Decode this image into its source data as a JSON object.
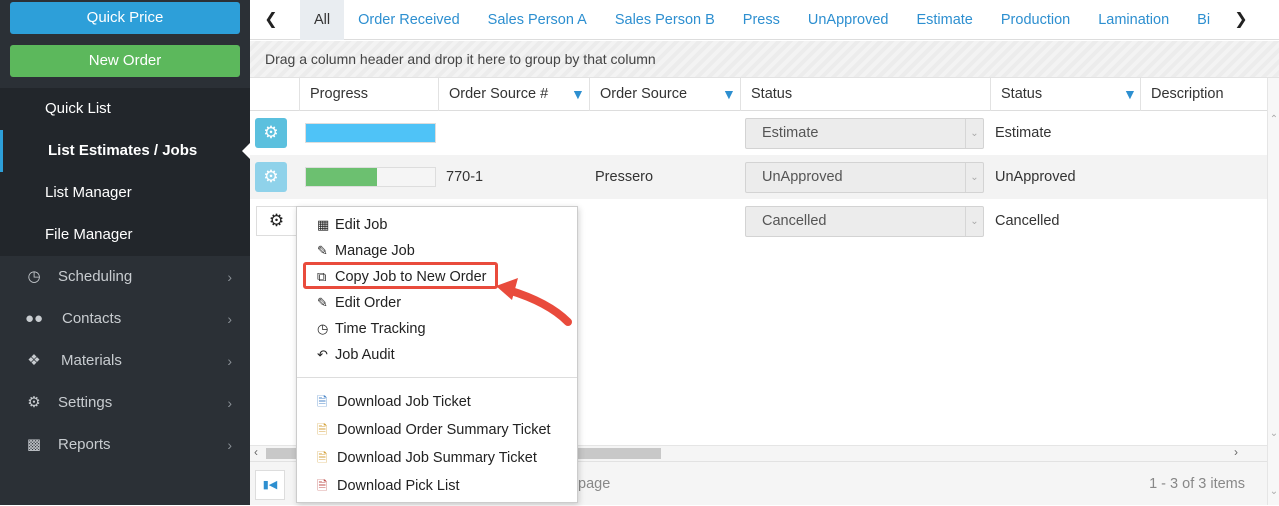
{
  "sidebar": {
    "quick_price": "Quick Price",
    "new_order": "New Order",
    "sub_items": [
      "Quick List",
      "List Estimates / Jobs",
      "List Manager",
      "File Manager"
    ],
    "nav": [
      {
        "label": "Scheduling",
        "icon": "clock-icon"
      },
      {
        "label": "Contacts",
        "icon": "users-icon"
      },
      {
        "label": "Materials",
        "icon": "dropbox-icon"
      },
      {
        "label": "Settings",
        "icon": "gear-icon"
      },
      {
        "label": "Reports",
        "icon": "file-icon"
      }
    ]
  },
  "tabs": [
    "All",
    "Order Received",
    "Sales Person A",
    "Sales Person B",
    "Press",
    "UnApproved",
    "Estimate",
    "Production",
    "Lamination",
    "Bi"
  ],
  "group_hint": "Drag a column header and drop it here to group by that column",
  "columns": [
    "Progress",
    "Order Source #",
    "Order Source",
    "Status",
    "Status",
    "Description"
  ],
  "rows": [
    {
      "progress": 1.0,
      "progress_color": "#4fc3f7",
      "source_no": "",
      "source": "",
      "status_select": "Estimate",
      "status": "Estimate"
    },
    {
      "progress": 0.55,
      "progress_color": "#6cc070",
      "source_no": "770-1",
      "source": "Pressero",
      "status_select": "UnApproved",
      "status": "UnApproved"
    },
    {
      "progress": 0,
      "progress_color": "#6cc070",
      "source_no": "",
      "source": "",
      "status_select": "Cancelled",
      "status": "Cancelled"
    }
  ],
  "menu": {
    "items": [
      "Edit Job",
      "Manage Job",
      "Copy Job to New Order",
      "Edit Order",
      "Time Tracking",
      "Job Audit"
    ],
    "downloads": [
      "Download Job Ticket",
      "Download Order Summary Ticket",
      "Download Job Summary Ticket",
      "Download Pick List"
    ]
  },
  "pager": {
    "per_page": "page",
    "info": "1 - 3 of 3 items"
  },
  "colors": {
    "accent": "#2d9fd9",
    "green": "#5cb85c",
    "sidebar": "#2b3036",
    "highlight": "#e94b3c"
  }
}
